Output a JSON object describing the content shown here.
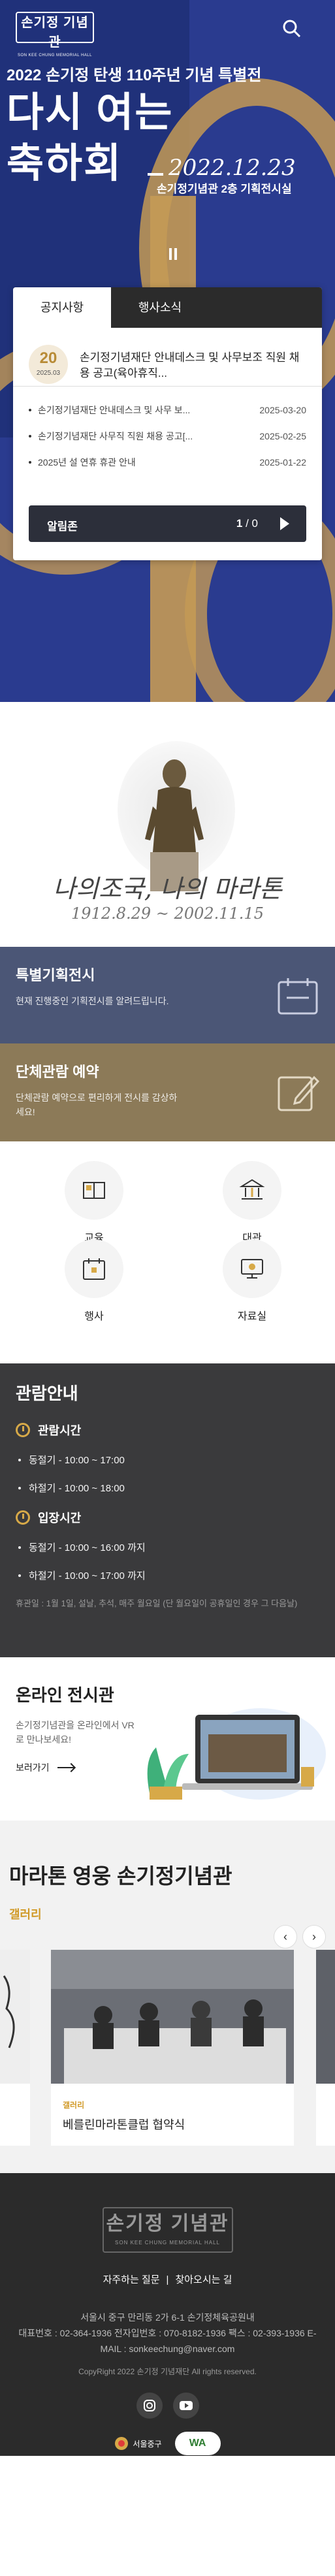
{
  "header": {
    "logo_ko": "손기정 기념관",
    "logo_en": "SON KEE CHUNG MEMORIAL HALL",
    "search_icon": "search-icon"
  },
  "hero": {
    "subtitle": "2022 손기정 탄생 110주년 기념 특별전",
    "title_line1": "다시 여는",
    "title_line2": "축하회",
    "date": "2022.12.23",
    "place": "손기정기념관 2층 기획전시실"
  },
  "notice": {
    "tabs": [
      "공지사항",
      "행사소식"
    ],
    "feature": {
      "day": "20",
      "yearmonth": "2025.03",
      "title": "손기정기념재단 안내데스크 및 사무보조 직원 채용 공고(육아휴직..."
    },
    "items": [
      {
        "title": "손기정기념재단 안내데스크 및 사무 보...",
        "date": "2025-03-20"
      },
      {
        "title": "손기정기념재단 사무직 직원 채용 공고[...",
        "date": "2025-02-25"
      },
      {
        "title": "2025년 설 연휴 휴관 안내",
        "date": "2025-01-22"
      }
    ],
    "alarm_label": "알림존",
    "alarm_current": "1",
    "alarm_sep": " / ",
    "alarm_total": "0"
  },
  "statue": {
    "caption1": "나의조국, 나의 마라톤",
    "caption2": "1912.8.29 ~ 2002.11.15"
  },
  "promo": {
    "special": {
      "title": "특별기획전시",
      "desc": "현재 진행중인 기획전시를 알려드립니다."
    },
    "group": {
      "title": "단체관람 예약",
      "desc": "단체관람 예약으로 편리하게 전시를 감상하세요!"
    }
  },
  "quick_menu": [
    "교육",
    "대관",
    "행사",
    "자료실"
  ],
  "hours": {
    "title": "관람안내",
    "open_label": "관람시간",
    "open_rows": [
      "동절기 - 10:00 ~ 17:00",
      "하절기 - 10:00 ~ 18:00"
    ],
    "entry_label": "입장시간",
    "entry_rows": [
      "동절기 - 10:00 ~ 16:00 까지",
      "하절기 - 10:00 ~ 17:00 까지"
    ],
    "note": "휴관일 : 1월 1일, 설날, 추석, 매주 월요일 (단 월요일이 공휴일인 경우 그 다음날)"
  },
  "online": {
    "title": "온라인 전시관",
    "desc": "손기정기념관을 온라인에서 VR로 만나보세요!",
    "more": "보러가기"
  },
  "gallery": {
    "title": "마라톤 영웅 손기정기념관",
    "tab": "갤러리",
    "prev": "‹",
    "next": "›",
    "card_category": "갤러리",
    "card_title": "베를린마라톤클럽 협약식"
  },
  "footer": {
    "logo_ko": "손기정 기념관",
    "logo_en": "SON KEE CHUNG MEMORIAL HALL",
    "link1": "자주하는 질문",
    "link2": "찾아오시는 길",
    "address": "서울시 중구 만리동 2가 6-1 손기정체육공원내",
    "contact": "대표번호 : 02-364-1936   전자입번호 : 070-8182-1936   팩스 : 02-393-1936   E-MAIL : sonkeechung@naver.com",
    "copyright": "CopyRight 2022 손기정 기념재단 All rights reserved.",
    "seoul_label": "서울중구",
    "wa_label": "WA"
  },
  "colors": {
    "hero_blue": "#2a3b8f",
    "gold": "#c49a55",
    "promo_blue": "#4b5676",
    "promo_gold": "#8c7a58",
    "dark": "#3a3a3c"
  }
}
